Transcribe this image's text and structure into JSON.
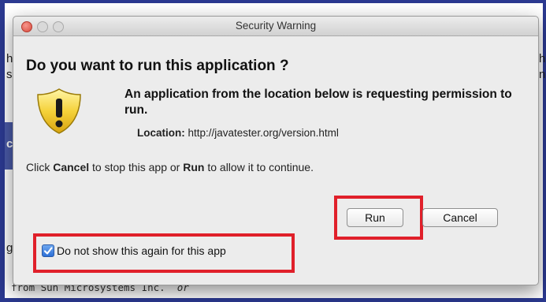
{
  "background": {
    "bottom_text_main": "from Sun Microsystems Inc.",
    "bottom_text_italic": "or",
    "left_letters": [
      "h",
      "s",
      "c",
      "g"
    ],
    "right_letters": [
      "h",
      "n"
    ]
  },
  "dialog": {
    "title": "Security Warning",
    "heading": "Do you want to run this application ?",
    "request_text": "An application from the location below is requesting permission to run.",
    "location_label": "Location:",
    "location_value": "http://javatester.org/version.html",
    "instruction_prefix": "Click",
    "instruction_cancel": "Cancel",
    "instruction_middle": "to stop this app or",
    "instruction_run": "Run",
    "instruction_suffix": "to allow it to continue.",
    "run_button": "Run",
    "cancel_button": "Cancel",
    "checkbox_label": "Do not show this again for this app",
    "checkbox_checked": true,
    "icon": "warning-shield-icon"
  },
  "colors": {
    "highlight": "#e0202a",
    "background_frame": "#2b3990",
    "dialog_bg": "#ececec"
  }
}
